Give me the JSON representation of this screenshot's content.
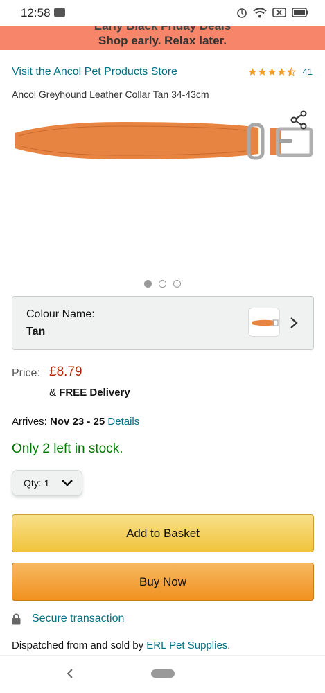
{
  "status_bar": {
    "time": "12:58"
  },
  "promo": {
    "top_text": "Early Black Friday Deals",
    "main_text": "Shop early. Relax later."
  },
  "product": {
    "store_link": "Visit the Ancol Pet Products Store",
    "rating_count": "41",
    "title": "Ancol Greyhound Leather Collar Tan 34-43cm",
    "image_dots": 3
  },
  "colour": {
    "label": "Colour Name:",
    "value": "Tan"
  },
  "price": {
    "label": "Price:",
    "value": "£8.79",
    "delivery_prefix": "& ",
    "delivery_bold": "FREE Delivery"
  },
  "arrives": {
    "label": "Arrives:",
    "date": "Nov 23 - 25",
    "details": "Details"
  },
  "stock": {
    "text": "Only 2 left in stock."
  },
  "quantity": {
    "label": "Qty:",
    "value": "1"
  },
  "buttons": {
    "add_to_basket": "Add to Basket",
    "buy_now": "Buy Now"
  },
  "secure": {
    "text": "Secure transaction"
  },
  "dispatched": {
    "prefix": "Dispatched from and sold by",
    "seller": "ERL Pet Supplies",
    "suffix": "."
  },
  "colors": {
    "accent_link": "#007185",
    "price": "#b12704",
    "stock": "#007600",
    "basket_button": "#f0c43c",
    "buy_button": "#f0911f",
    "promo_banner": "#f7856a",
    "star": "#f29c24"
  }
}
